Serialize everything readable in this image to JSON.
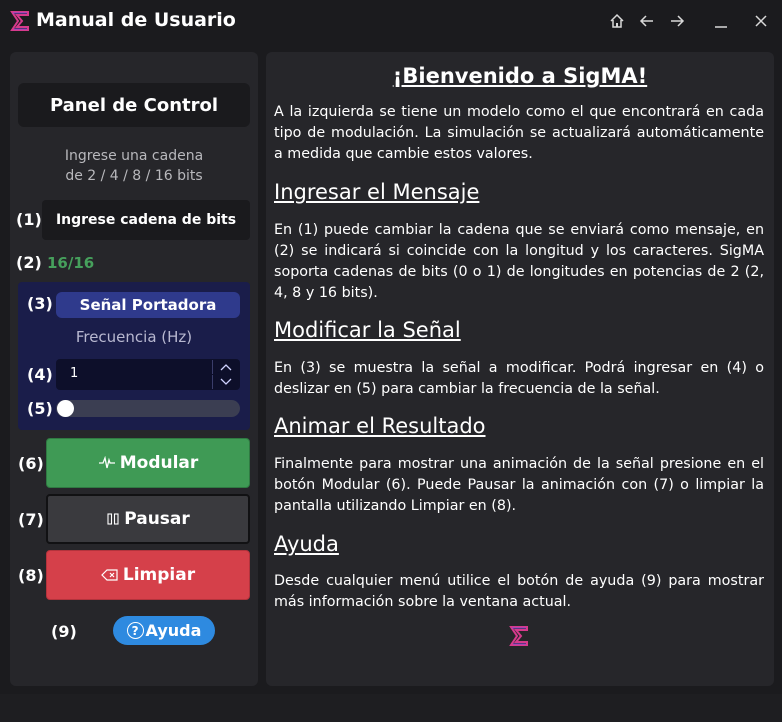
{
  "window": {
    "title": "Manual de Usuario",
    "controls": {
      "home_icon": "home-icon",
      "back_icon": "arrow-left-icon",
      "forward_icon": "arrow-right-icon",
      "minimize_glyph": "—",
      "close_glyph": "✕"
    }
  },
  "left": {
    "header": "Panel de Control",
    "hint_line1": "Ingrese una cadena",
    "hint_line2": "de 2 / 4 / 8 / 16 bits",
    "labels": {
      "n1": "(1)",
      "n2": "(2)",
      "n3": "(3)",
      "n4": "(4)",
      "n5": "(5)",
      "n6": "(6)",
      "n7": "(7)",
      "n8": "(8)",
      "n9": "(9)"
    },
    "bits_input": {
      "value": "",
      "placeholder": "Ingrese cadena de bits"
    },
    "bit_count": "16/16",
    "carrier": {
      "title": "Señal Portadora",
      "freq_label": "Frecuencia (Hz)",
      "freq_value": "1",
      "slider_level": 0.0
    },
    "buttons": {
      "modulate": "Modular",
      "pause": "Pausar",
      "clear": "Limpiar",
      "help": "Ayuda"
    }
  },
  "right": {
    "welcome": "¡Bienvenido a SigMA!",
    "intro": "A la izquierda se tiene un modelo como el que encontrará en cada tipo de modulación. La simulación se actualizará automáticamente a medida que cambie estos valores.",
    "sections": [
      {
        "title": "Ingresar el Mensaje",
        "body": "En (1) puede cambiar la cadena que se enviará como mensaje, en (2) se indicará si coincide con la longitud y los caracteres. SigMA soporta cadenas de bits (0 o 1) de longitudes en potencias de 2 (2, 4, 8 y 16 bits)."
      },
      {
        "title": "Modificar la Señal",
        "body": "En (3) se muestra la señal a modificar. Podrá ingresar en (4) o deslizar en (5) para cambiar la frecuencia de la señal."
      },
      {
        "title": "Animar el Resultado",
        "body": "Finalmente para mostrar una animación de la señal presione en el botón Modular (6). Puede Pausar la animación con (7) o limpiar la pantalla utilizando Limpiar en (8)."
      },
      {
        "title": "Ayuda",
        "body": "Desde cualquier menú utilice el botón de ayuda (9) para mostrar más información sobre la ventana actual."
      }
    ]
  },
  "colors": {
    "background": "#1b1b1e",
    "panel": "#26262a",
    "accent_green": "#3f9a55",
    "accent_red": "#d5404a",
    "accent_blue": "#2e8ae0",
    "carrier_box": "#1a1d4a",
    "count_ok": "#46a05c"
  }
}
